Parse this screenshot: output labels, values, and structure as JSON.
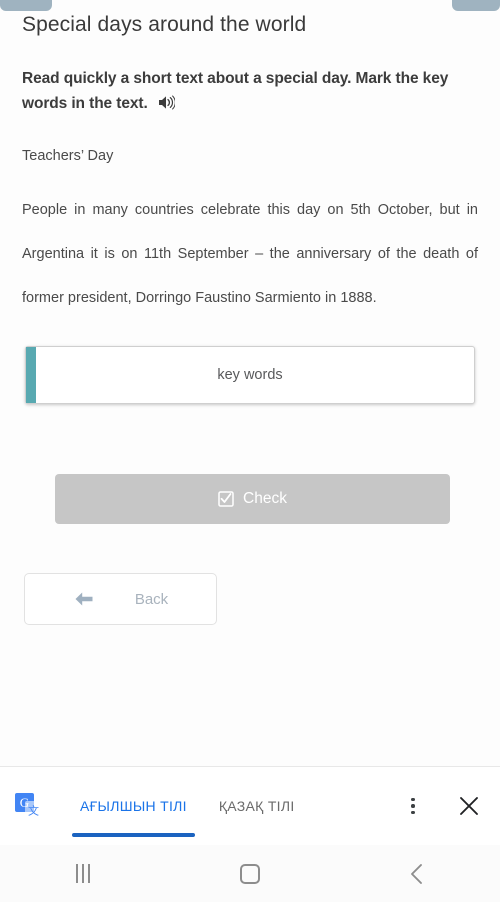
{
  "top_chips": {
    "left_label": "",
    "right_label": ""
  },
  "lesson": {
    "title": "Special days around the world",
    "instruction": "Read quickly a short text about a special day. Mark the key words in the text.",
    "audio_icon": "speaker-icon",
    "text_heading": "Teachers’  Day",
    "text_body": "People in many countries celebrate this day on 5th October, but in Argentina it is on 11th September – the anniversary of the death of former president, Dorringo Faustino Sarmiento in 1888."
  },
  "answer": {
    "placeholder": "key words",
    "value": "",
    "accent_color": "#58a9b1"
  },
  "actions": {
    "check_label": "Check",
    "check_icon": "checkbox-checked-icon",
    "check_disabled_color": "#c6c6c6",
    "back_label": "Back",
    "back_icon": "arrow-left-icon"
  },
  "translate_bar": {
    "logo_icon": "google-translate-icon",
    "tabs": [
      {
        "label": "АҒЫЛШЫН ТІЛІ",
        "active": true
      },
      {
        "label": "ҚАЗАҚ ТІЛІ",
        "active": false
      }
    ],
    "menu_icon": "overflow-menu-icon",
    "close_icon": "close-icon",
    "accent_color": "#1a73e8"
  },
  "nav_bar": {
    "recents_icon": "recents-icon",
    "home_icon": "home-icon",
    "back_icon": "back-chevron-icon"
  }
}
